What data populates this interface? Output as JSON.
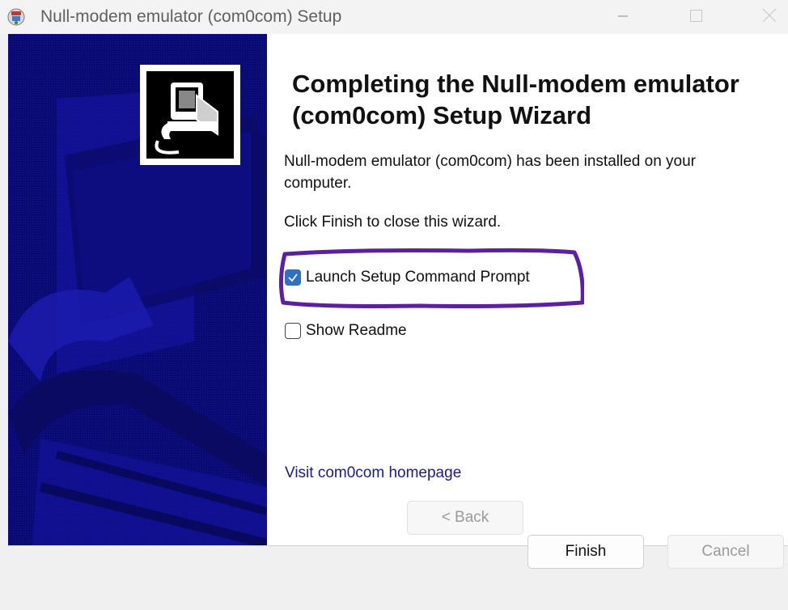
{
  "window": {
    "title": "Null-modem emulator (com0com) Setup"
  },
  "wizard": {
    "heading": "Completing the Null-modem emulator (com0com) Setup Wizard",
    "installed_text": "Null-modem emulator (com0com) has been installed on your computer.",
    "finish_hint": "Click Finish to close this wizard.",
    "options": [
      {
        "label": "Launch Setup Command Prompt",
        "checked": true
      },
      {
        "label": "Show Readme",
        "checked": false
      }
    ],
    "homepage_link": "Visit com0com homepage"
  },
  "buttons": {
    "back": "< Back",
    "finish": "Finish",
    "cancel": "Cancel"
  },
  "colors": {
    "side_panel": "#0b0b7a",
    "highlight_annotation": "#5a1fa6",
    "checkbox_accent": "#2f6fc4",
    "link": "#1a1a8a"
  }
}
